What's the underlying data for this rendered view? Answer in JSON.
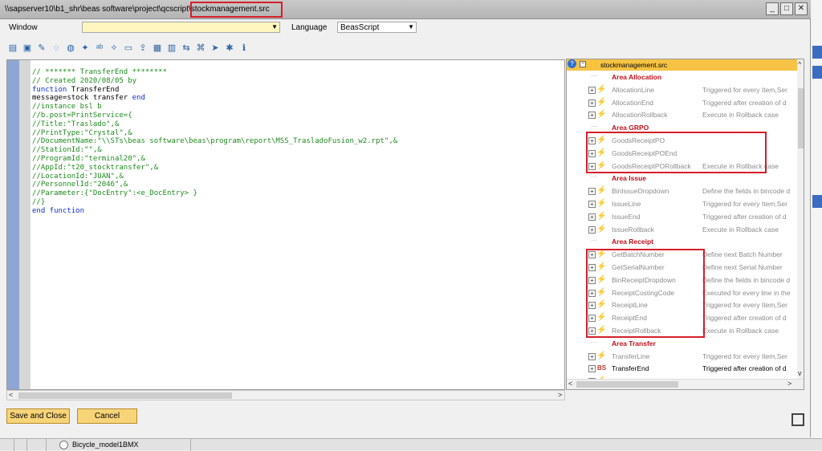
{
  "window": {
    "title_path": "\\\\sapserver10\\b1_shr\\beas software\\project\\qcscript\\",
    "title_file": "stockmanagement.src",
    "minimize": "_",
    "maximize": "□",
    "close": "✕"
  },
  "topbar": {
    "window_label": "Window",
    "window_value": "",
    "language_label": "Language",
    "language_value": "BeasScript"
  },
  "toolbar_icons": [
    "new-file-icon",
    "save-icon",
    "edit-icon",
    "comment-icon",
    "uncomment-icon",
    "wand-icon",
    "spellcheck-icon",
    "magic-icon",
    "text-icon",
    "export-icon",
    "excel-icon",
    "pdf-icon",
    "text-direction-icon",
    "translate-icon",
    "run-icon",
    "debug-icon",
    "info-icon"
  ],
  "code_lines": [
    {
      "t": "// ******* TransferEnd ********",
      "c": "comment"
    },
    {
      "t": "// Created 2020/08/05 by",
      "c": "comment"
    },
    {
      "t": "function TransferEnd",
      "c": "mixed_function"
    },
    {
      "t": "message=stock transfer end",
      "c": "mixed_end"
    },
    {
      "t": "//instance bsl b",
      "c": "comment"
    },
    {
      "t": "//b.post=PrintService={",
      "c": "comment"
    },
    {
      "t": "//Title:\"Traslado\",&",
      "c": "comment"
    },
    {
      "t": "//PrintType:\"Crystal\",&",
      "c": "comment"
    },
    {
      "t": "//DocumentName:\"\\\\STs\\beas software\\beas\\program\\report\\MSS_TrasladoFusion_w2.rpt\",&",
      "c": "comment"
    },
    {
      "t": "//StationId:\"\",&",
      "c": "comment"
    },
    {
      "t": "//ProgramId:\"terminal20\",&",
      "c": "comment"
    },
    {
      "t": "//AppId:\"t20_stocktransfer\",&",
      "c": "comment"
    },
    {
      "t": "//LocationId:\"JUAN\",&",
      "c": "comment"
    },
    {
      "t": "//PersonnelId:\"2046\",&",
      "c": "comment"
    },
    {
      "t": "//Parameter:{\"DocEntry\":<e_DocEntry> }",
      "c": "comment"
    },
    {
      "t": "//}",
      "c": "comment"
    },
    {
      "t": "end function",
      "c": "keyword"
    }
  ],
  "tree": {
    "root": "stockmanagement.src",
    "rows": [
      {
        "type": "area",
        "name": "Area Allocation"
      },
      {
        "type": "item",
        "name": "AllocationLine",
        "desc": "Triggered for every Item,Ser"
      },
      {
        "type": "item",
        "name": "AllocationEnd",
        "desc": "Triggered after creation of d"
      },
      {
        "type": "item",
        "name": "AllocationRollback",
        "desc": "Execute in Rollback case"
      },
      {
        "type": "area",
        "name": "Area GRPO"
      },
      {
        "type": "item",
        "name": "GoodsReceiptPO",
        "desc": ""
      },
      {
        "type": "item",
        "name": "GoodsReceiptPOEnd",
        "desc": ""
      },
      {
        "type": "item",
        "name": "GoodsReceiptPORollback",
        "desc": "Execute in Rollback case"
      },
      {
        "type": "area",
        "name": "Area Issue"
      },
      {
        "type": "item",
        "name": "BinIssueDropdown",
        "desc": "Define the fields in bincode d"
      },
      {
        "type": "item",
        "name": "IssueLine",
        "desc": "Triggered for every Item,Ser"
      },
      {
        "type": "item",
        "name": "IssueEnd",
        "desc": "Triggered after creation of d"
      },
      {
        "type": "item",
        "name": "IssueRollback",
        "desc": "Execute in Rollback case"
      },
      {
        "type": "area",
        "name": "Area Receipt"
      },
      {
        "type": "item",
        "name": "GetBatchNumber",
        "desc": "Define next Batch Number"
      },
      {
        "type": "item",
        "name": "GetSerialNumber",
        "desc": "Define next Serial Number"
      },
      {
        "type": "item",
        "name": "BinReceiptDropdown",
        "desc": "Define the fields in bincode d"
      },
      {
        "type": "item",
        "name": "ReceiptCostingCode",
        "desc": "Executed for every line in the"
      },
      {
        "type": "item",
        "name": "ReceiptLine",
        "desc": "Triggered for every Item,Ser"
      },
      {
        "type": "item",
        "name": "ReceiptEnd",
        "desc": "Triggered after creation of d"
      },
      {
        "type": "item",
        "name": "ReceiptRollback",
        "desc": "Execute in Rollback case"
      },
      {
        "type": "area",
        "name": "Area Transfer"
      },
      {
        "type": "item",
        "name": "TransferLine",
        "desc": "Triggered for every Item,Ser"
      },
      {
        "type": "active",
        "name": "TransferEnd",
        "desc": "Triggered after creation of d",
        "badge": "BS"
      },
      {
        "type": "item",
        "name": "TransferRollback",
        "desc": "Execute in Rollback case"
      }
    ]
  },
  "buttons": {
    "save_close": "Save and Close",
    "cancel": "Cancel"
  },
  "taskbar": {
    "radio_label": "Bicycle_model1BMX"
  },
  "colors": {
    "highlight_box": "#d41f2a",
    "area_heading": "#c0101b",
    "comment": "#1f8a1f",
    "keyword": "#1030c8"
  }
}
